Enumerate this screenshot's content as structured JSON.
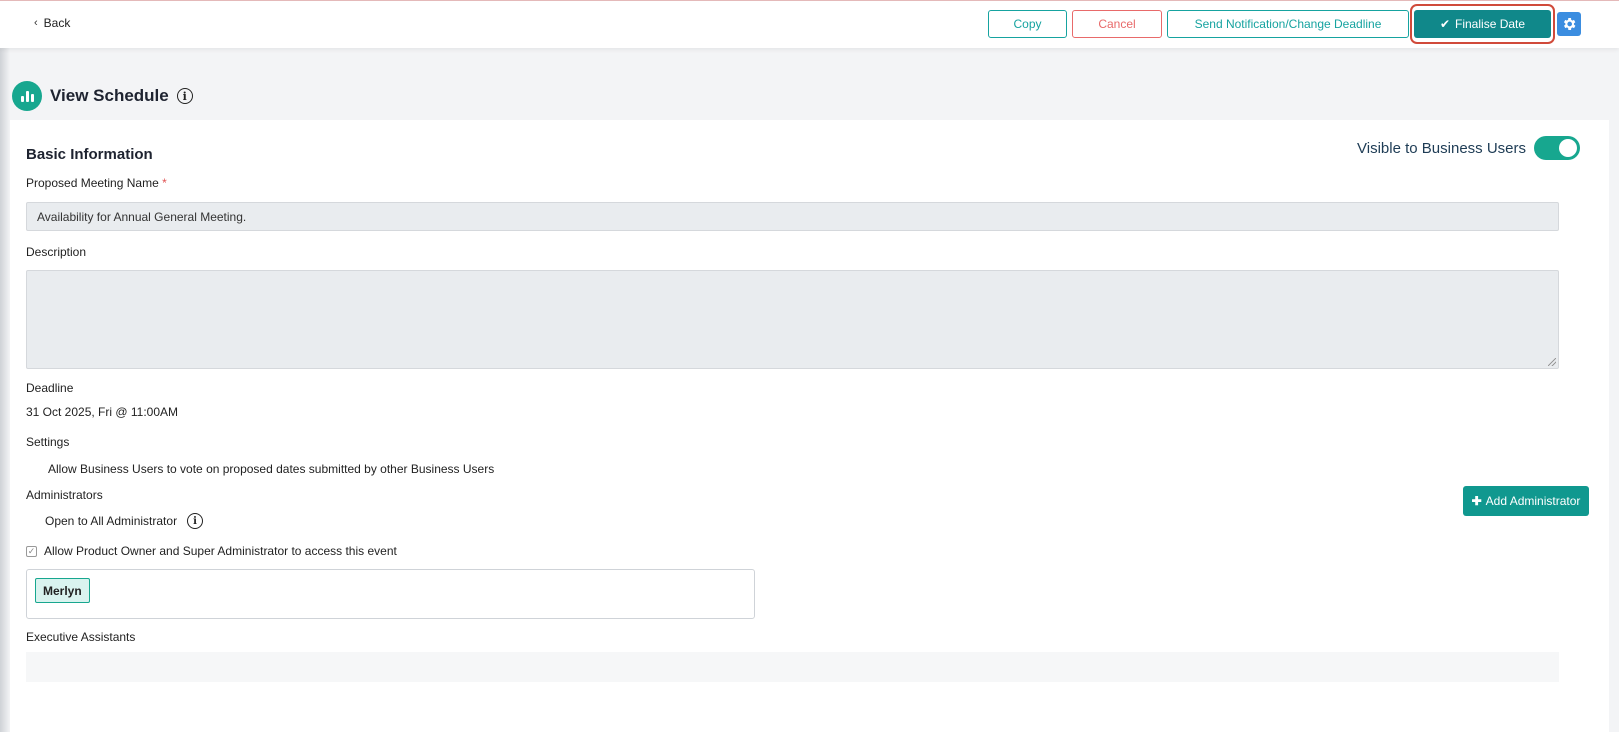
{
  "topbar": {
    "back_label": "Back",
    "copy_label": "Copy",
    "cancel_label": "Cancel",
    "notify_label": "Send Notification/Change Deadline",
    "finalise_label": "Finalise Date"
  },
  "page": {
    "title": "View Schedule"
  },
  "basic_info": {
    "section_title": "Basic Information",
    "visible_label": "Visible to Business Users",
    "visible_on": true,
    "meeting_name_label": "Proposed Meeting Name",
    "meeting_name_required": "*",
    "meeting_name_value": "Availability for Annual General Meeting.",
    "description_label": "Description",
    "description_value": "",
    "deadline_label": "Deadline",
    "deadline_value": "31 Oct 2025, Fri @ 11:00AM",
    "settings_label": "Settings",
    "settings_value": "Allow Business Users to vote on proposed dates submitted by other Business Users",
    "administrators_label": "Administrators",
    "add_admin_label": "Add Administrator",
    "open_admin_label": "Open to All Administrator",
    "allow_access_label": "Allow Product Owner and Super Administrator to access this event",
    "admin_chips": [
      "Merlyn"
    ],
    "ea_label": "Executive Assistants"
  },
  "colors": {
    "accent": "#16a3a0",
    "cancel": "#e86a6a",
    "finalise_bg": "#10888a",
    "highlight_ring": "#d04a3a",
    "gear_bg": "#3b8de0"
  }
}
